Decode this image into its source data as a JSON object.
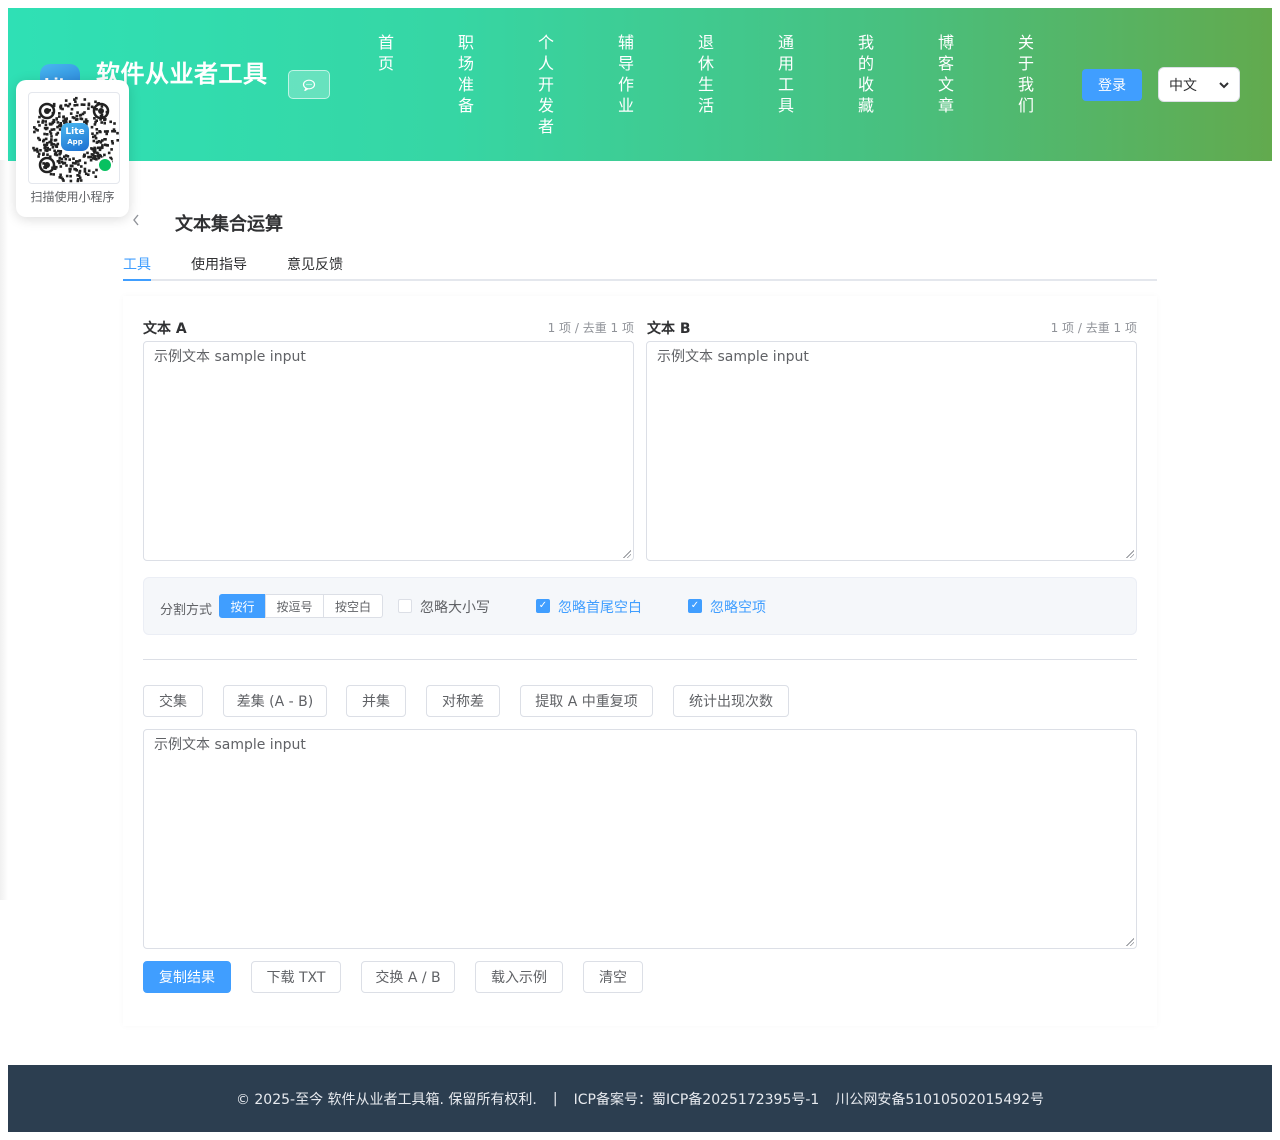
{
  "header": {
    "logo_text": "Lite",
    "title": "软件从业者工具",
    "nav": [
      "首页",
      "职场准备",
      "个人开发者",
      "辅导作业",
      "退休生活",
      "通用工具",
      "我的收藏",
      "博客文章",
      "关于我们"
    ],
    "login_label": "登录",
    "language": "中文",
    "chat_icon": "chat-bubble-icon"
  },
  "qr": {
    "badge_text_1": "Lite",
    "badge_text_2": "App",
    "caption": "扫描使用小程序"
  },
  "page": {
    "back_icon": "chevron-left-icon",
    "title": "文本集合运算",
    "tabs": [
      "工具",
      "使用指导",
      "意见反馈"
    ],
    "active_tab": "工具"
  },
  "inputs": {
    "a": {
      "label": "文本 A",
      "meta": "1 项 / 去重 1 项",
      "value": "示例文本 sample input"
    },
    "b": {
      "label": "文本 B",
      "meta": "1 项 / 去重 1 项",
      "value": "示例文本 sample input"
    }
  },
  "options": {
    "split_label": "分割方式",
    "split_modes": [
      "按行",
      "按逗号",
      "按空白"
    ],
    "active_split": "按行",
    "ignore_case": {
      "label": "忽略大小写",
      "checked": false
    },
    "trim": {
      "label": "忽略首尾空白",
      "checked": true
    },
    "ignore_empty": {
      "label": "忽略空项",
      "checked": true
    }
  },
  "operations": [
    "交集",
    "差集 (A - B)",
    "并集",
    "对称差",
    "提取 A 中重复项",
    "统计出现次数"
  ],
  "result": {
    "value": "示例文本 sample input"
  },
  "actions": [
    "复制结果",
    "下载 TXT",
    "交换 A / B",
    "载入示例",
    "清空"
  ],
  "footer": {
    "copyright": "© 2025-至今 软件从业者工具箱. 保留所有权利.",
    "separator": "|",
    "icp": "ICP备案号：蜀ICP备2025172395号-1",
    "police": "川公网安备51010502015492号"
  },
  "colors": {
    "accent": "#409eff",
    "header_start": "#2fe0b5",
    "header_end": "#62aa4e",
    "footer_bg": "#2c3e50"
  }
}
